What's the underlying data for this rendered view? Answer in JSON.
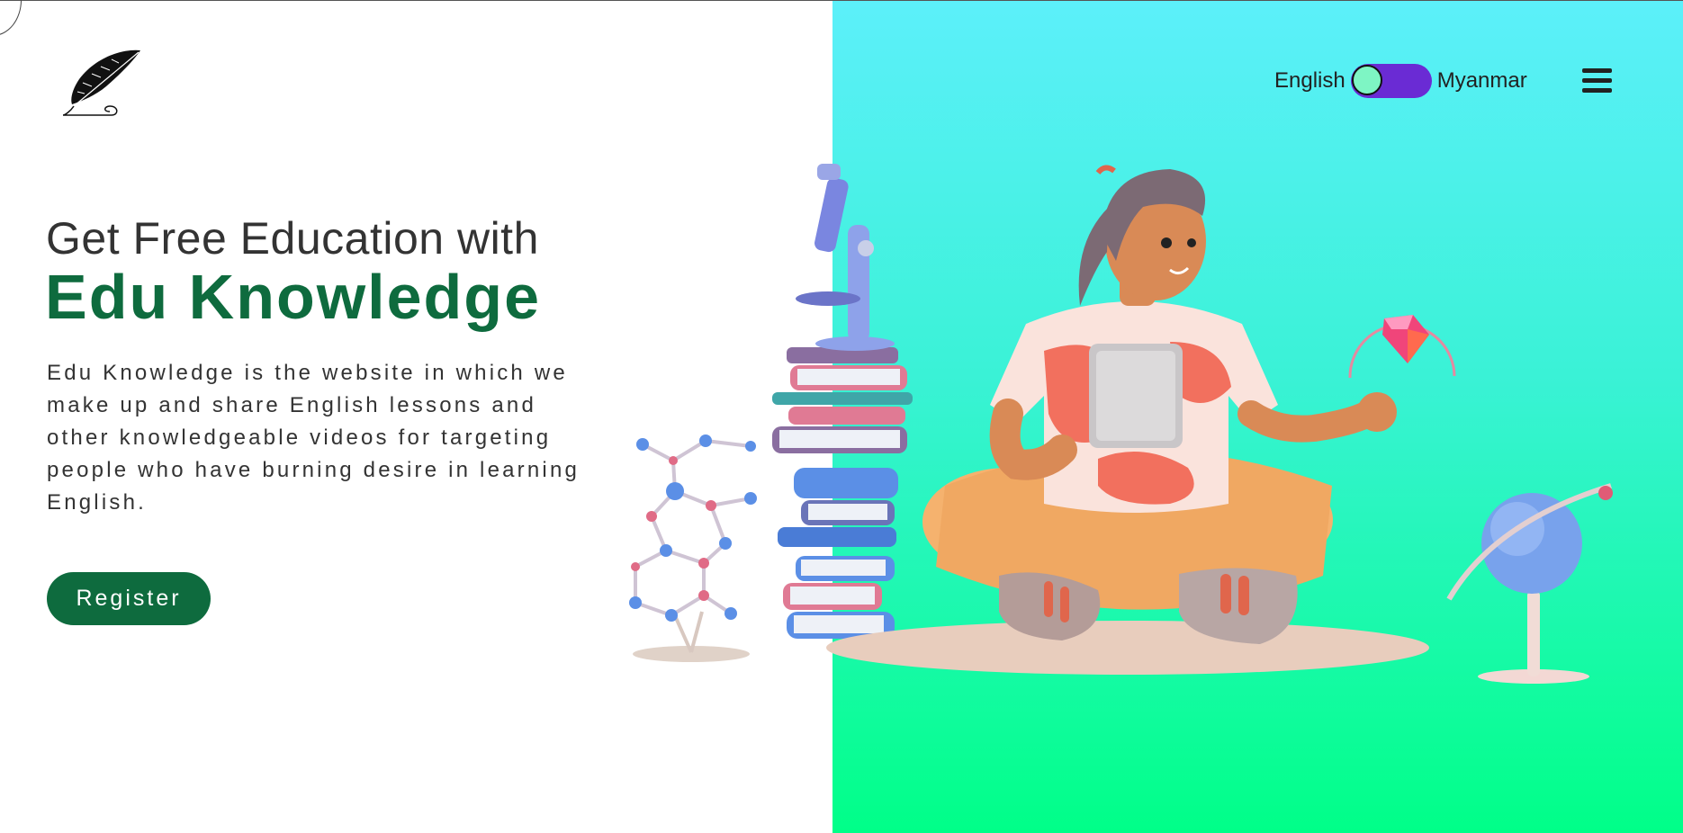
{
  "header": {
    "logo_icon": "quill-feather-icon",
    "language_toggle": {
      "left_label": "English",
      "right_label": "Myanmar",
      "selected": "English"
    },
    "menu_icon": "hamburger-menu-icon"
  },
  "hero": {
    "headline": "Get Free Education with",
    "brand": "Edu Knowledge",
    "description": "Edu Knowledge is the website in which we make up and share English lessons and other knowledgeable videos for targeting people who have burning desire in learning English.",
    "register_label": "Register",
    "illustration": "student-with-tablet-illustration"
  },
  "colors": {
    "brand_green": "#0e6b3e",
    "toggle_purple": "#6a2bd4",
    "gradient_top": "#5cf0fa",
    "gradient_bottom": "#00ff88"
  }
}
